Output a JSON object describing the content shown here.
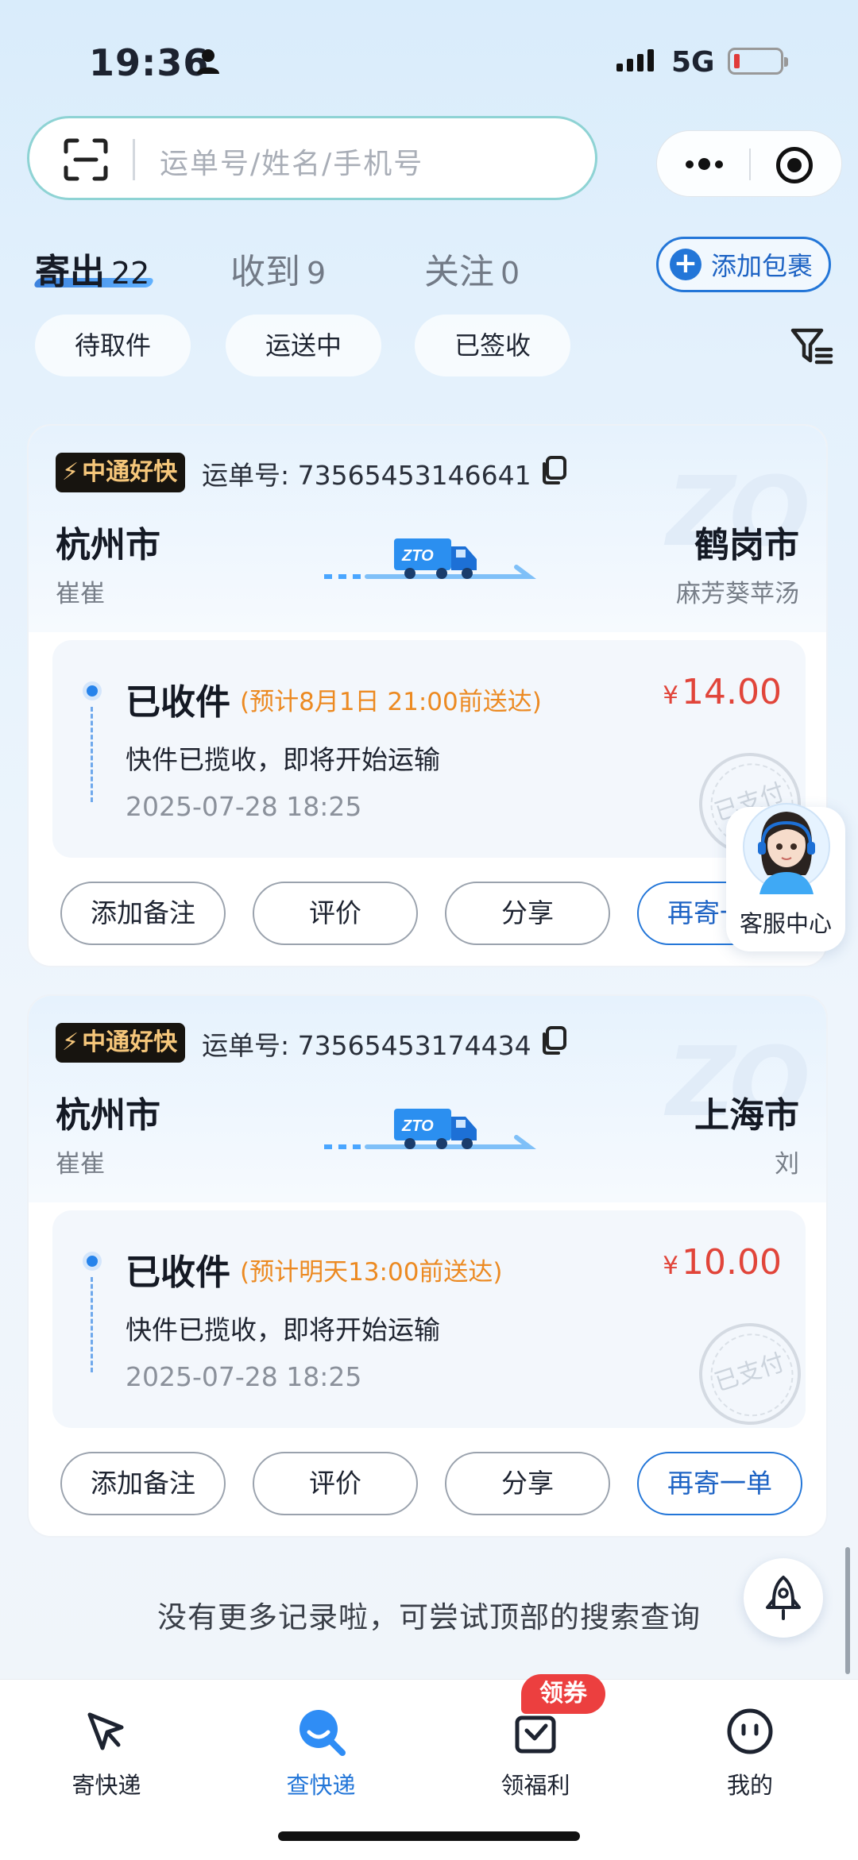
{
  "status_bar": {
    "time": "19:36",
    "network": "5G",
    "battery_color": "#e03b3b"
  },
  "search": {
    "placeholder": "运单号/姓名/手机号"
  },
  "tabs": [
    {
      "label": "寄出",
      "count": "22",
      "active": true
    },
    {
      "label": "收到",
      "count": "9",
      "active": false
    },
    {
      "label": "关注",
      "count": "0",
      "active": false
    }
  ],
  "add_package_label": "添加包裹",
  "filters": [
    "待取件",
    "运送中",
    "已签收"
  ],
  "cards": [
    {
      "brand": "中通好快",
      "waybill_label": "运单号:",
      "waybill_no": "73565453146641",
      "from_city": "杭州市",
      "from_person": "崔崔",
      "to_city": "鹤岗市",
      "to_person": "麻芳葵苹汤",
      "status": "已收件",
      "eta": "(预计8月1日 21:00前送达)",
      "price": "14.00",
      "desc": "快件已揽收，即将开始运输",
      "time": "2025-07-28 18:25",
      "stamp": "已支付",
      "buttons": [
        "添加备注",
        "评价",
        "分享",
        "再寄一单"
      ]
    },
    {
      "brand": "中通好快",
      "waybill_label": "运单号:",
      "waybill_no": "73565453174434",
      "from_city": "杭州市",
      "from_person": "崔崔",
      "to_city": "上海市",
      "to_person": "刘",
      "status": "已收件",
      "eta": "(预计明天13:00前送达)",
      "price": "10.00",
      "desc": "快件已揽收，即将开始运输",
      "time": "2025-07-28 18:25",
      "stamp": "已支付",
      "buttons": [
        "添加备注",
        "评价",
        "分享",
        "再寄一单"
      ]
    }
  ],
  "currency": "¥",
  "service_center": "客服中心",
  "no_more_text": "没有更多记录啦，可尝试顶部的搜索查询",
  "bottom_nav": [
    {
      "label": "寄快递",
      "icon": "send-icon",
      "active": false
    },
    {
      "label": "查快递",
      "icon": "search-express-icon",
      "active": true
    },
    {
      "label": "领福利",
      "icon": "gift-icon",
      "active": false
    },
    {
      "label": "我的",
      "icon": "profile-icon",
      "active": false
    }
  ],
  "coupon_badge": "领券",
  "colors": {
    "accent": "#2376d8",
    "price": "#e1453a",
    "eta": "#ec8a22",
    "brand_bg": "#17140f",
    "brand_text": "#f5c67a"
  }
}
